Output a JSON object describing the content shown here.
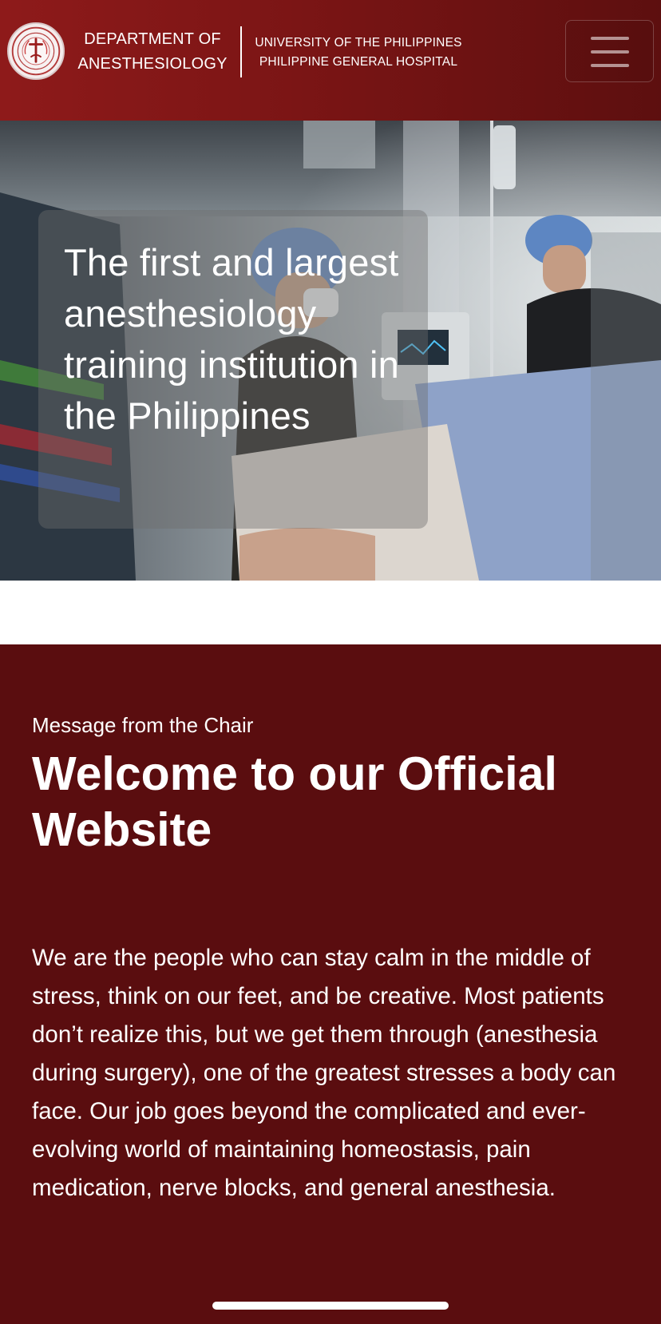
{
  "header": {
    "logo_icon": "department-seal",
    "department_line1": "DEPARTMENT OF",
    "department_line2": "ANESTHESIOLOGY",
    "org_line1": "UNIVERSITY OF THE PHILIPPINES",
    "org_line2": "PHILIPPINE GENERAL HOSPITAL",
    "menu_icon": "hamburger-menu-icon"
  },
  "hero": {
    "headline": "The first and largest anesthesiology training institution in the Philippines",
    "image": "operating-room-photo"
  },
  "message": {
    "kicker": "Message from the Chair",
    "title": "Welcome to our Official Website",
    "body": "We are the people who can stay calm in the middle of stress, think on our feet, and be creative. Most patients don’t realize this, but we get them through (anesthesia during surgery), one of the greatest stresses a body can face. Our job goes beyond the complicated and ever-evolving world of maintaining homeostasis, pain medication, nerve blocks, and general anesthesia."
  },
  "colors": {
    "header_red": "#8e1a1a",
    "section_maroon": "#5a0d0f",
    "text_white": "#ffffff"
  }
}
